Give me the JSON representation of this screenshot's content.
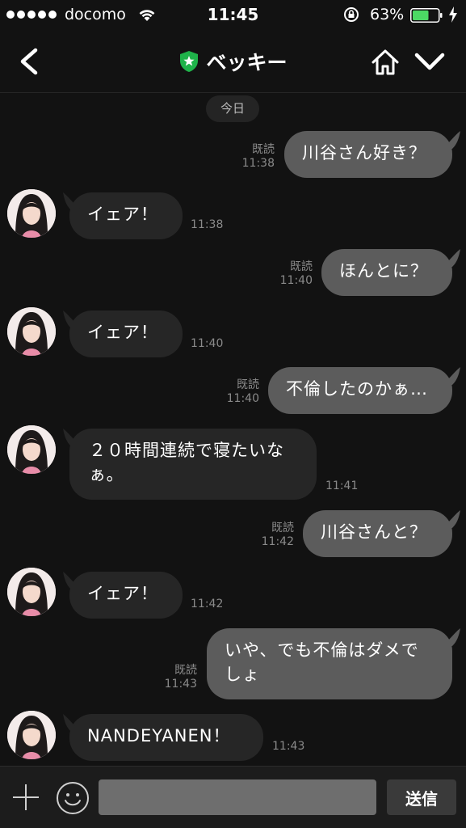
{
  "status_bar": {
    "carrier": "docomo",
    "time": "11:45",
    "battery_percent": "63%",
    "battery_level": 0.63,
    "icons": [
      "signal-dots",
      "wifi-icon",
      "rotation-lock-icon",
      "battery-icon",
      "charging-bolt-icon"
    ]
  },
  "header": {
    "title": "ベッキー",
    "icons": [
      "back-chevron-icon",
      "official-shield-icon",
      "home-icon",
      "chevron-down-icon"
    ],
    "colors": {
      "shield": "#1fb34a"
    }
  },
  "chat": {
    "date_label": "今日",
    "messages": [
      {
        "sender": "me",
        "text": "川谷さん好き？",
        "read": "既読",
        "time": "11:38"
      },
      {
        "sender": "them",
        "text": "イェア！",
        "time": "11:38"
      },
      {
        "sender": "me",
        "text": "ほんとに？",
        "read": "既読",
        "time": "11:40"
      },
      {
        "sender": "them",
        "text": "イェア！",
        "time": "11:40"
      },
      {
        "sender": "me",
        "text": "不倫したのかぁ…",
        "read": "既読",
        "time": "11:40"
      },
      {
        "sender": "them",
        "text": "２０時間連続で寝たいなぁ。",
        "line1": "２０時間連続で寝たいな",
        "line2": "ぁ。",
        "time": "11:41"
      },
      {
        "sender": "me",
        "text": "川谷さんと？",
        "read": "既読",
        "time": "11:42"
      },
      {
        "sender": "them",
        "text": "イェア！",
        "time": "11:42"
      },
      {
        "sender": "me",
        "text": "いや、でも不倫はダメでしょ",
        "line1": "いや、でも不倫はダメで",
        "line2": "しょ",
        "read": "既読",
        "time": "11:43"
      },
      {
        "sender": "them",
        "text": "NANDEYANEN！",
        "time": "11:43"
      }
    ],
    "colors": {
      "incoming_bubble": "#262626",
      "outgoing_bubble": "#5c5c5c",
      "background": "#121212"
    }
  },
  "input_bar": {
    "placeholder": "",
    "value": "",
    "send_label": "送信",
    "icons": [
      "plus-icon",
      "emoji-icon"
    ]
  }
}
